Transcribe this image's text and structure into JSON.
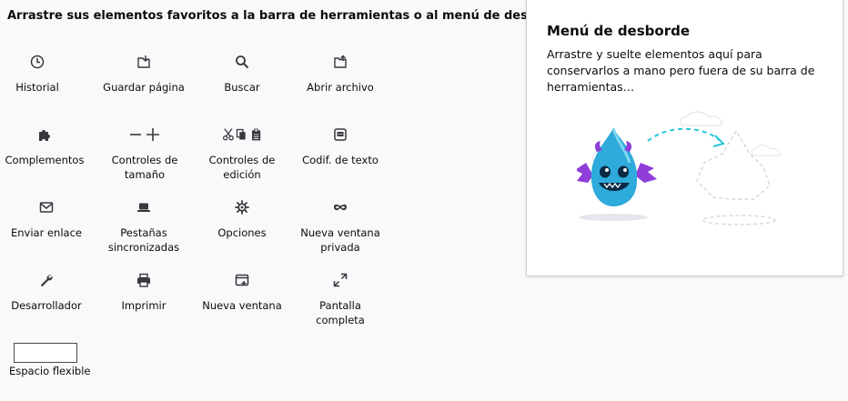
{
  "instructions": "Arrastre sus elementos favoritos a la barra de herramientas o al menú de desborde.",
  "palette": {
    "items": [
      {
        "label": "Historial",
        "icon": "clock-icon"
      },
      {
        "label": "Guardar página",
        "icon": "save-page-icon"
      },
      {
        "label": "Buscar",
        "icon": "search-icon"
      },
      {
        "label": "Abrir archivo",
        "icon": "open-file-icon"
      },
      {
        "label": "Complementos",
        "icon": "puzzle-icon"
      },
      {
        "label": "Controles de tamaño",
        "icon": "zoom-controls-icon"
      },
      {
        "label": "Controles de edición",
        "icon": "edit-controls-icon"
      },
      {
        "label": "Codif. de texto",
        "icon": "text-encoding-icon"
      },
      {
        "label": "Enviar enlace",
        "icon": "mail-icon"
      },
      {
        "label": "Pestañas sincronizadas",
        "icon": "synced-tabs-icon"
      },
      {
        "label": "Opciones",
        "icon": "gear-icon"
      },
      {
        "label": "Nueva ventana privada",
        "icon": "private-mask-icon"
      },
      {
        "label": "Desarrollador",
        "icon": "wrench-icon"
      },
      {
        "label": "Imprimir",
        "icon": "printer-icon"
      },
      {
        "label": "Nueva ventana",
        "icon": "new-window-icon"
      },
      {
        "label": "Pantalla completa",
        "icon": "fullscreen-icon"
      }
    ],
    "flexible_space": "Espacio flexible"
  },
  "overflow_panel": {
    "title": "Menú de desborde",
    "description": "Arrastre y suelte elementos aquí para conservarlos a mano pero fuera de su barra de herramientas…"
  },
  "colors": {
    "background": "#f9f9fb",
    "text": "#0c0c0d",
    "mascot_blue": "#2eaadb",
    "mascot_purple": "#8f3fd8",
    "accent_cyan": "#27c6da"
  }
}
